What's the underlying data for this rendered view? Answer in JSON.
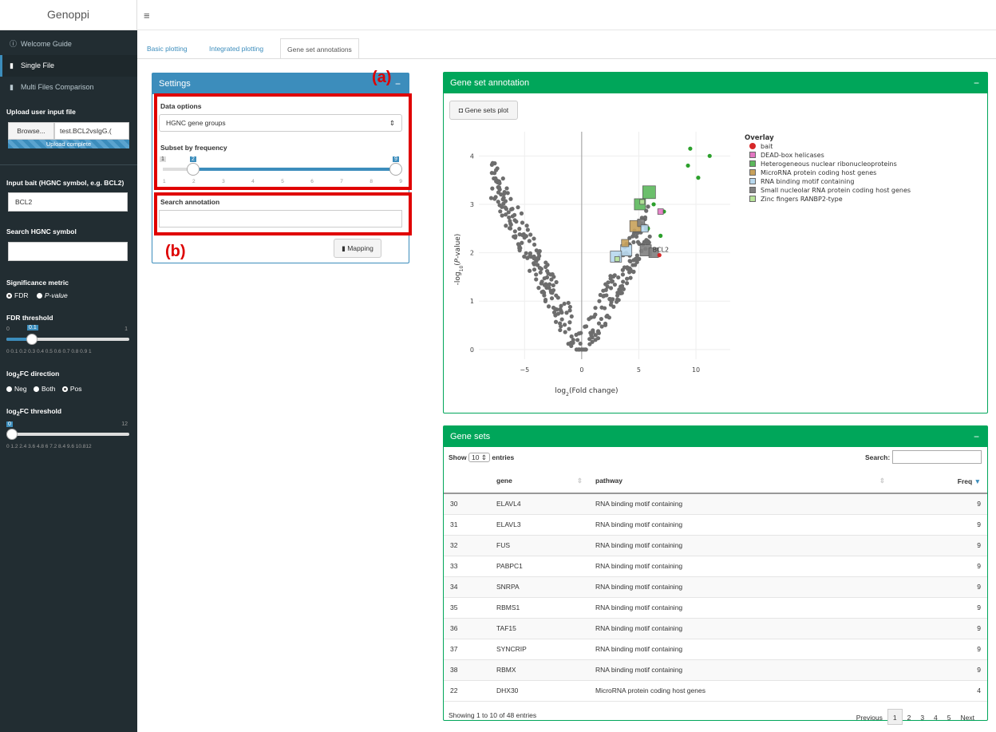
{
  "app": {
    "title": "Genoppi"
  },
  "sidebar": {
    "items": [
      {
        "label": "Welcome Guide",
        "icon": "info-circle-icon"
      },
      {
        "label": "Single File",
        "icon": "file-icon"
      },
      {
        "label": "Multi Files Comparison",
        "icon": "files-icon"
      }
    ],
    "upload_label": "Upload user input file",
    "browse_label": "Browse...",
    "file_name": "test.BCL2vsIgG.(",
    "upload_status": "Upload complete",
    "bait_label": "Input bait (HGNC symbol, e.g. BCL2)",
    "bait_value": "BCL2",
    "hgnc_label": "Search HGNC symbol",
    "hgnc_value": "",
    "sig_label": "Significance metric",
    "sig_options": [
      "FDR",
      "P-value"
    ],
    "sig_selected": "FDR",
    "fdr_label": "FDR threshold",
    "fdr_min": "0",
    "fdr_max": "1",
    "fdr_value": "0.1",
    "fdr_value_num": 0.1,
    "fdr_ticks": "0  0.1 0.2 0.3 0.4 0.5 0.6 0.7 0.8 0.9  1",
    "dir_label": "log2FC direction",
    "dir_options": [
      "Neg",
      "Both",
      "Pos"
    ],
    "dir_selected": "Pos",
    "fc_label": "log2FC threshold",
    "fc_min": "0",
    "fc_max": "12",
    "fc_value": "0",
    "fc_value_num": 0,
    "fc_ticks": "0  1.2 2.4 3.6 4.8  6  7.2 8.4 9.6 10.812"
  },
  "tabs": [
    {
      "label": "Basic plotting"
    },
    {
      "label": "Integrated plotting"
    },
    {
      "label": "Gene set annotations"
    }
  ],
  "settings": {
    "title": "Settings",
    "annot_a": "(a)",
    "annot_b": "(b)",
    "data_options_label": "Data options",
    "data_options_value": "HGNC gene groups",
    "subset_label": "Subset by frequency",
    "subset_min": "1",
    "subset_max": "9",
    "subset_low": "2",
    "subset_high": "9",
    "subset_ticks": [
      "1",
      "2",
      "3",
      "4",
      "5",
      "6",
      "7",
      "8",
      "9"
    ],
    "search_label": "Search annotation",
    "search_value": "",
    "mapping_label": "Mapping"
  },
  "geneset_panel": {
    "title": "Gene set annotation",
    "button_label": "Gene sets plot"
  },
  "chart_data": {
    "type": "scatter",
    "xlabel": "log2(Fold change)",
    "ylabel": "-log10(P-value)",
    "xticks": [
      "−5",
      "0",
      "5",
      "10"
    ],
    "yticks": [
      "0",
      "1",
      "2",
      "3",
      "4"
    ],
    "xlim": [
      -9,
      13
    ],
    "ylim": [
      -0.2,
      4.5
    ],
    "legend_title": "Overlay",
    "legend": [
      {
        "name": "bait",
        "color": "#d62728",
        "shape": "circle"
      },
      {
        "name": "DEAD-box helicases",
        "color": "#e377c2",
        "shape": "square"
      },
      {
        "name": "Heterogeneous nuclear ribonucleoproteins",
        "color": "#5cb85c",
        "shape": "square"
      },
      {
        "name": "MicroRNA protein coding host genes",
        "color": "#c8a15a",
        "shape": "square"
      },
      {
        "name": "RNA binding motif containing",
        "color": "#b8d8ee",
        "shape": "square"
      },
      {
        "name": "Small nucleolar RNA protein coding host genes",
        "color": "#808080",
        "shape": "square"
      },
      {
        "name": "Zinc fingers RANBP2-type",
        "color": "#b8e39a",
        "shape": "square"
      }
    ],
    "label": "BCL2"
  },
  "table": {
    "title": "Gene sets",
    "show_label": "Show",
    "entries_value": "10",
    "entries_label": "entries",
    "search_label": "Search:",
    "headers": [
      "",
      "gene",
      "pathway",
      "Freq"
    ],
    "rows": [
      [
        "30",
        "ELAVL4",
        "RNA binding motif containing",
        "9"
      ],
      [
        "31",
        "ELAVL3",
        "RNA binding motif containing",
        "9"
      ],
      [
        "32",
        "FUS",
        "RNA binding motif containing",
        "9"
      ],
      [
        "33",
        "PABPC1",
        "RNA binding motif containing",
        "9"
      ],
      [
        "34",
        "SNRPA",
        "RNA binding motif containing",
        "9"
      ],
      [
        "35",
        "RBMS1",
        "RNA binding motif containing",
        "9"
      ],
      [
        "36",
        "TAF15",
        "RNA binding motif containing",
        "9"
      ],
      [
        "37",
        "SYNCRIP",
        "RNA binding motif containing",
        "9"
      ],
      [
        "38",
        "RBMX",
        "RNA binding motif containing",
        "9"
      ],
      [
        "22",
        "DHX30",
        "MicroRNA protein coding host genes",
        "4"
      ]
    ],
    "info": "Showing 1 to 10 of 48 entries",
    "pagination": [
      "Previous",
      "1",
      "2",
      "3",
      "4",
      "5",
      "Next"
    ]
  },
  "colors": {
    "green": "#00a65a",
    "blue": "#3c8dbc",
    "sidebar": "#222d32"
  }
}
